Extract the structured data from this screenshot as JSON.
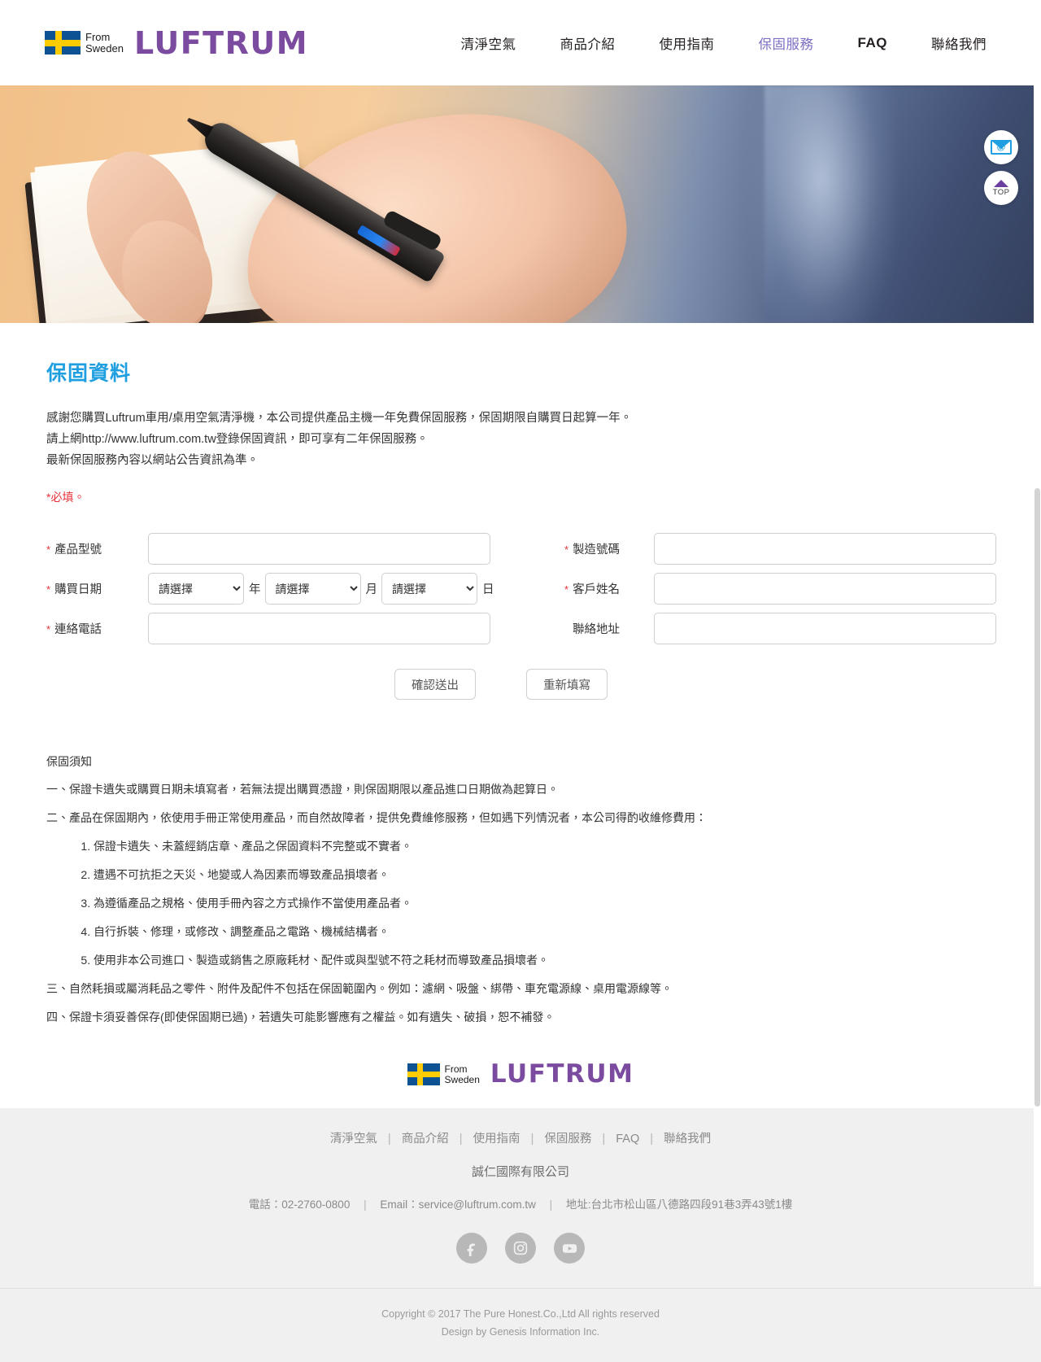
{
  "header": {
    "logo": {
      "flag_line1": "From",
      "flag_line2": "Sweden",
      "wordmark": "LUFTRUM"
    },
    "nav": [
      {
        "label": "清淨空氣",
        "active": false,
        "latin": false
      },
      {
        "label": "商品介紹",
        "active": false,
        "latin": false
      },
      {
        "label": "使用指南",
        "active": false,
        "latin": false
      },
      {
        "label": "保固服務",
        "active": true,
        "latin": false
      },
      {
        "label": "FAQ",
        "active": false,
        "latin": true
      },
      {
        "label": "聯絡我們",
        "active": false,
        "latin": false
      }
    ]
  },
  "side_buttons": {
    "mail_at": "@",
    "top_label": "TOP"
  },
  "main": {
    "page_title": "保固資料",
    "intro_lines": [
      "感謝您購買Luftrum車用/桌用空氣清淨機，本公司提供產品主機一年免費保固服務，保固期限自購買日起算一年。",
      "請上網http://www.luftrum.com.tw登錄保固資訊，即可享有二年保固服務。",
      "最新保固服務內容以網站公告資訊為準。"
    ],
    "required_note": "*必填。"
  },
  "form": {
    "product_model": {
      "label": "產品型號",
      "required": true,
      "value": "",
      "placeholder": ""
    },
    "serial_number": {
      "label": "製造號碼",
      "required": true,
      "value": "",
      "placeholder": ""
    },
    "purchase_date": {
      "label": "購買日期",
      "required": true,
      "year": {
        "selected": "請選擇",
        "unit": "年"
      },
      "month": {
        "selected": "請選擇",
        "unit": "月"
      },
      "day": {
        "selected": "請選擇",
        "unit": "日"
      }
    },
    "customer_name": {
      "label": "客戶姓名",
      "required": true,
      "value": "",
      "placeholder": ""
    },
    "phone": {
      "label": "連絡電話",
      "required": true,
      "value": "",
      "placeholder": ""
    },
    "address": {
      "label": "聯絡地址",
      "required": false,
      "value": "",
      "placeholder": ""
    },
    "submit_label": "確認送出",
    "reset_label": "重新填寫"
  },
  "terms": {
    "heading": "保固須知",
    "item1": "一、保證卡遺失或購買日期未填寫者，若無法提出購買憑證，則保固期限以產品進口日期做為起算日。",
    "item2": "二、產品在保固期內，依使用手冊正常使用產品，而自然故障者，提供免費維修服務，但如遇下列情況者，本公司得酌收維修費用：",
    "sub_items": [
      "保證卡遺失、未蓋經銷店章、產品之保固資料不完整或不實者。",
      "遭遇不可抗拒之天災、地變或人為因素而導致產品損壞者。",
      "為遵循產品之規格、使用手冊內容之方式操作不當使用產品者。",
      "自行拆裝、修理，或修改、調整產品之電路、機械結構者。",
      "使用非本公司進口、製造或銷售之原廠耗材、配件或與型號不符之耗材而導致產品損壞者。"
    ],
    "item3": "三、自然耗損或屬消耗品之零件、附件及配件不包括在保固範圍內。例如：濾網、吸盤、綁帶、車充電源線、桌用電源線等。",
    "item4": "四、保證卡須妥善保存(即使保固期已過)，若遺失可能影響應有之權益。如有遺失、破損，恕不補發。"
  },
  "footer": {
    "logo": {
      "flag_line1": "From",
      "flag_line2": "Sweden",
      "wordmark": "LUFTRUM"
    },
    "nav": [
      "清淨空氣",
      "商品介紹",
      "使用指南",
      "保固服務",
      "FAQ",
      "聯絡我們"
    ],
    "company": "誠仁國際有限公司",
    "phone": "電話：02-2760-0800",
    "email": "Email：service@luftrum.com.tw",
    "address": "地址:台北市松山區八德路四段91巷3弄43號1樓",
    "socials": [
      "facebook-icon",
      "instagram-icon",
      "youtube-icon"
    ],
    "copyright_line1": "Copyright © 2017 The Pure Honest.Co.,Ltd All rights reserved",
    "copyright_line2": "Design by Genesis Information Inc."
  },
  "colors": {
    "brand_purple": "#7b4ba0",
    "nav_active": "#7b6fc4",
    "title_blue": "#1f9fe0",
    "required_red": "#e8313a",
    "footer_bg": "#f0f0f0"
  }
}
